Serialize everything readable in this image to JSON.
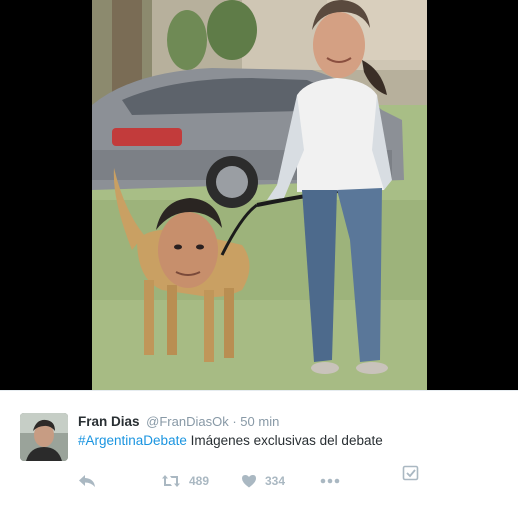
{
  "tweet": {
    "author_name": "Fran Dias",
    "author_handle": "@FranDiasOk",
    "separator": "·",
    "timestamp": "50 min",
    "hashtag": "#ArgentinaDebate",
    "text": "Imágenes exclusivas del debate"
  },
  "actions": {
    "retweet_count": "489",
    "like_count": "334"
  },
  "icons": {
    "reply": "reply-icon",
    "retweet": "retweet-icon",
    "like": "heart-icon",
    "more": "more-dots-icon",
    "embed": "checkbox-icon"
  },
  "colors": {
    "link": "#1b95e0",
    "name": "#292f33",
    "meta": "#8899a6",
    "action": "#aab8c2"
  }
}
